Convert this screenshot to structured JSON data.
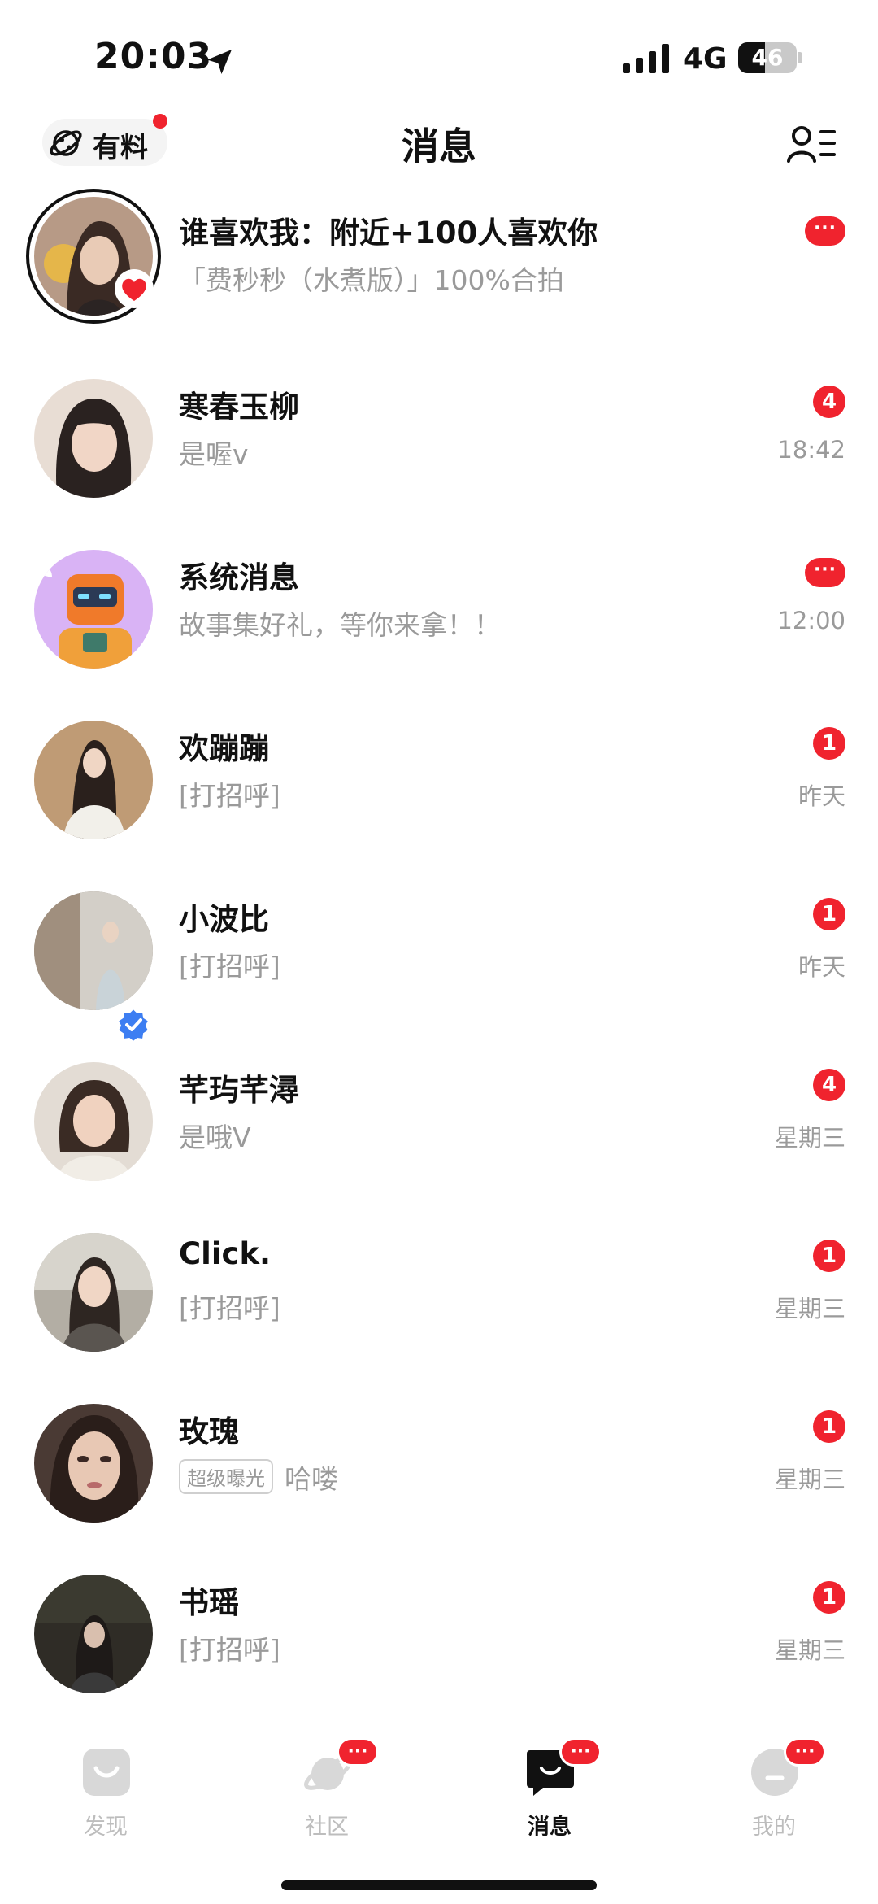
{
  "status_bar": {
    "time": "20:03",
    "network": "4G",
    "battery": "46",
    "battery_level": 0.46
  },
  "header": {
    "left_button_label": "有料",
    "title": "消息"
  },
  "messages": [
    {
      "name": "谁喜欢我：附近+100人喜欢你",
      "preview": "「费秒秒（水煮版）」100%合拍",
      "time": "",
      "badge": "···",
      "badge_type": "dots",
      "avatar_color": "#c9a58a"
    },
    {
      "name": "寒春玉柳",
      "preview": "是喔v",
      "time": "18:42",
      "badge": "4",
      "badge_type": "count",
      "avatar_color": "#d9b8a6"
    },
    {
      "name": "系统消息",
      "preview": "故事集好礼，等你来拿！！",
      "time": "12:00",
      "badge": "···",
      "badge_type": "dots",
      "avatar_color": "#d7b3f0"
    },
    {
      "name": "欢蹦蹦",
      "preview": "[打招呼]",
      "time": "昨天",
      "badge": "1",
      "badge_type": "count",
      "avatar_color": "#c8b29a"
    },
    {
      "name": "小波比",
      "preview": "[打招呼]",
      "time": "昨天",
      "badge": "1",
      "badge_type": "count",
      "avatar_color": "#9a8f85"
    },
    {
      "name": "芊玙芊潯",
      "preview": "是哦V",
      "time": "星期三",
      "badge": "4",
      "badge_type": "count",
      "avatar_color": "#cfc4bc"
    },
    {
      "name": "Click.",
      "preview": "[打招呼]",
      "time": "星期三",
      "badge": "1",
      "badge_type": "count",
      "avatar_color": "#a9a59c"
    },
    {
      "name": "玫瑰",
      "preview_tag": "超级曝光",
      "preview": "哈喽",
      "time": "星期三",
      "badge": "1",
      "badge_type": "count",
      "avatar_color": "#6d5a52"
    },
    {
      "name": "书瑶",
      "preview": "[打招呼]",
      "time": "星期三",
      "badge": "1",
      "badge_type": "count",
      "avatar_color": "#3d3a34"
    }
  ],
  "bottom_nav": [
    {
      "label": "发现",
      "badge": ""
    },
    {
      "label": "社区",
      "badge": "···"
    },
    {
      "label": "消息",
      "badge": "···"
    },
    {
      "label": "我的",
      "badge": "···"
    }
  ],
  "colors": {
    "accent_red": "#f0232e",
    "muted_text": "#9a9a9a",
    "nav_inactive": "#bdbdbd"
  }
}
